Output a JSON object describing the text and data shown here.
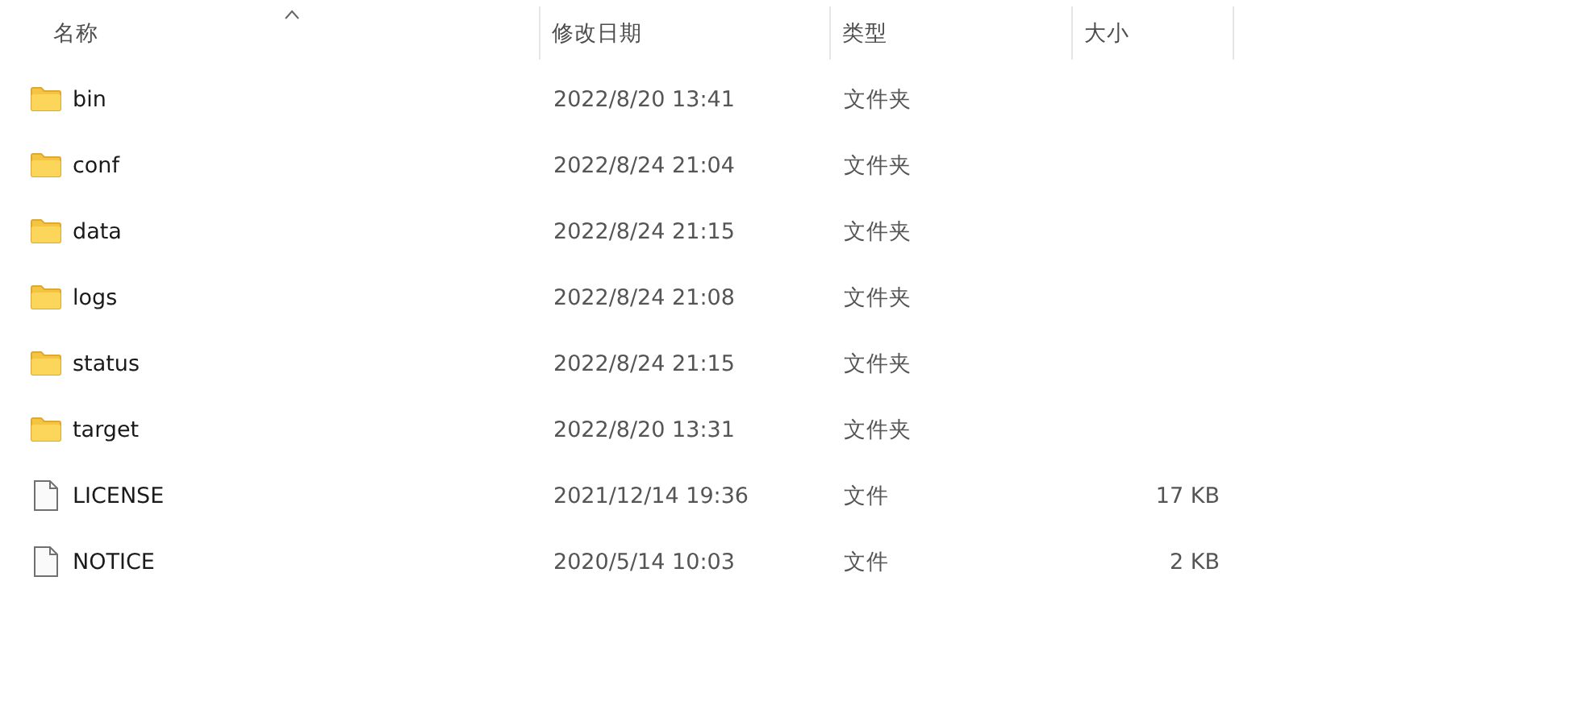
{
  "columns": [
    {
      "label": "名称",
      "sorted": true
    },
    {
      "label": "修改日期",
      "sorted": false
    },
    {
      "label": "类型",
      "sorted": false
    },
    {
      "label": "大小",
      "sorted": false
    }
  ],
  "rows": [
    {
      "kind": "folder",
      "name": "bin",
      "modified": "2022/8/20 13:41",
      "type": "文件夹"
    },
    {
      "kind": "folder",
      "name": "conf",
      "modified": "2022/8/24 21:04",
      "type": "文件夹"
    },
    {
      "kind": "folder",
      "name": "data",
      "modified": "2022/8/24 21:15",
      "type": "文件夹"
    },
    {
      "kind": "folder",
      "name": "logs",
      "modified": "2022/8/24 21:08",
      "type": "文件夹"
    },
    {
      "kind": "folder",
      "name": "status",
      "modified": "2022/8/24 21:15",
      "type": "文件夹"
    },
    {
      "kind": "folder",
      "name": "target",
      "modified": "2022/8/20 13:31",
      "type": "文件夹"
    },
    {
      "kind": "file",
      "name": "LICENSE",
      "modified": "2021/12/14 19:36",
      "type": "文件",
      "size": "17 KB"
    },
    {
      "kind": "file",
      "name": "NOTICE",
      "modified": "2020/5/14 10:03",
      "type": "文件",
      "size": "2 KB"
    }
  ]
}
